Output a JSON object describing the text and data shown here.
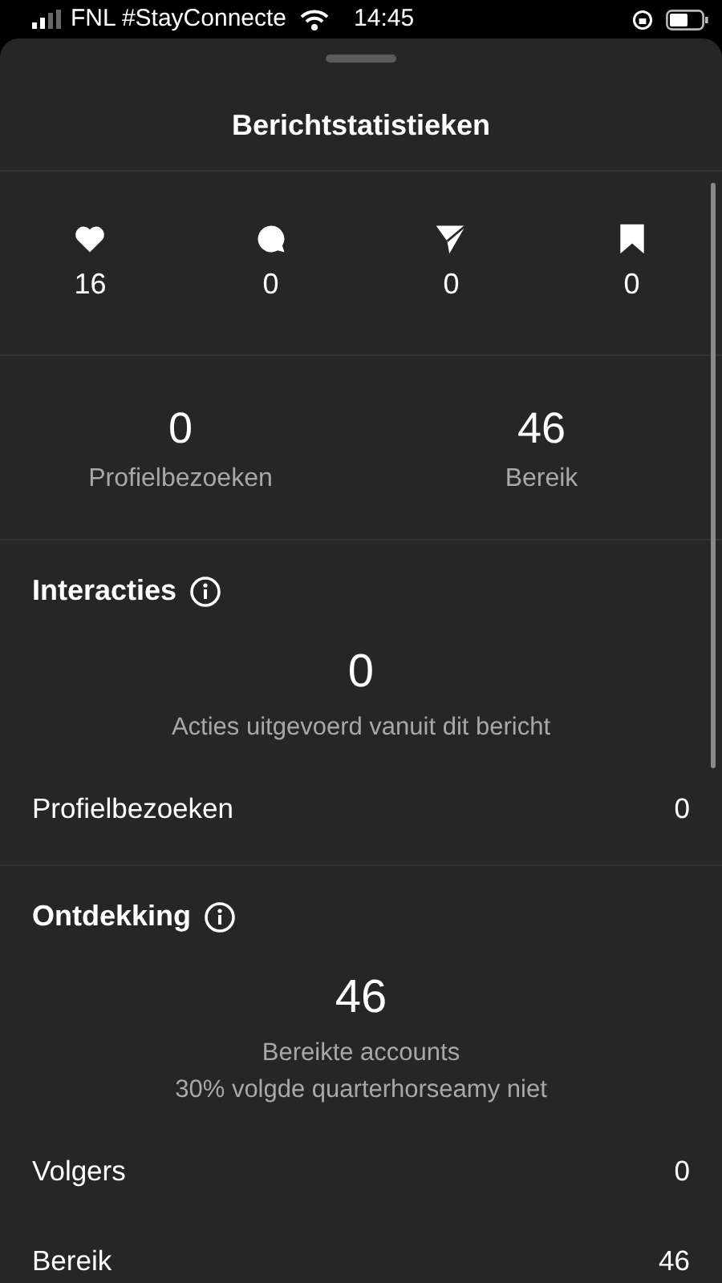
{
  "status_bar": {
    "carrier": "FNL #StayConnecte",
    "time": "14:45"
  },
  "title": "Berichtstatistieken",
  "engagement": [
    {
      "kind": "like",
      "value": "16"
    },
    {
      "kind": "comment",
      "value": "0"
    },
    {
      "kind": "share",
      "value": "0"
    },
    {
      "kind": "save",
      "value": "0"
    }
  ],
  "summary": [
    {
      "value": "0",
      "label": "Profielbezoeken"
    },
    {
      "value": "46",
      "label": "Bereik"
    }
  ],
  "sections": [
    {
      "title": "Interacties",
      "big_value": "0",
      "captions": [
        "Acties uitgevoerd vanuit dit bericht"
      ],
      "rows": [
        {
          "label": "Profielbezoeken",
          "value": "0"
        }
      ]
    },
    {
      "title": "Ontdekking",
      "big_value": "46",
      "captions": [
        "Bereikte accounts",
        "30% volgde quarterhorseamy niet"
      ],
      "rows": [
        {
          "label": "Volgers",
          "value": "0"
        },
        {
          "label": "Bereik",
          "value": "46"
        }
      ]
    }
  ]
}
